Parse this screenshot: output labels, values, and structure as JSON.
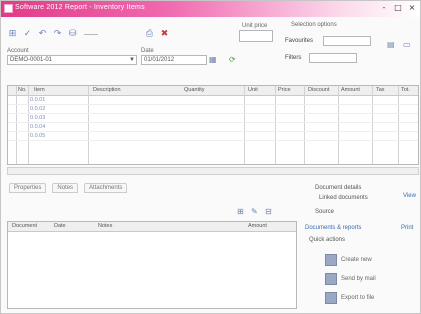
{
  "window": {
    "title": "Software 2012 Report - Inventory Items",
    "controls": [
      "-",
      "□",
      "×"
    ]
  },
  "toolbar": {
    "icons": [
      {
        "name": "save-icon",
        "glyph": "⊞"
      },
      {
        "name": "check-icon",
        "glyph": "✓"
      },
      {
        "name": "undo-icon",
        "glyph": "↶"
      },
      {
        "name": "redo-icon",
        "glyph": "↷"
      },
      {
        "name": "filter-icon",
        "glyph": "⛁"
      },
      {
        "name": "print-icon",
        "glyph": "⎙"
      },
      {
        "name": "delete-icon",
        "glyph": "✖"
      }
    ],
    "right_label": "Unit price"
  },
  "form": {
    "account_label": "Account",
    "account_value": "DEMO-0001-01",
    "date_label": "Date",
    "date_value": "01/01/2012"
  },
  "right_panel": {
    "group_label": "Selection options",
    "option1_label": "Favourites",
    "option2_label": "Filters"
  },
  "grid": {
    "headers": [
      "No.",
      "Item",
      "Description",
      "Quantity",
      "Unit",
      "Price",
      "Discount",
      "Amount",
      "Tax",
      "Tot."
    ],
    "rows": [
      "0.0.01",
      "0.0.02",
      "0.0.03",
      "0.0.04",
      "0.0.05"
    ]
  },
  "tabs": [
    "Properties",
    "Notes",
    "Attachments"
  ],
  "list": {
    "headers": [
      "Document",
      "Date",
      "Notes",
      "Amount"
    ]
  },
  "side": {
    "title1": "Document details",
    "link1": "View",
    "subtitle1": "Linked documents",
    "label2": "Source",
    "section2": "Documents & reports",
    "link2": "Print",
    "section3": "Quick actions",
    "items": [
      "Create new",
      "Send by mail",
      "Export to file"
    ]
  }
}
